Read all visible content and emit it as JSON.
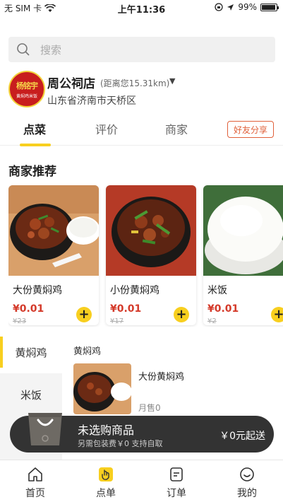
{
  "status_bar": {
    "carrier": "无 SIM 卡",
    "time": "上午11:36",
    "battery": "99%"
  },
  "search": {
    "placeholder": "搜索"
  },
  "store": {
    "logo_main": "杨铭宇",
    "logo_sub": "黄焖鸡米饭",
    "name": "周公祠店",
    "distance": "(距离您15.31km)",
    "caret": "▼",
    "address": "山东省济南市天桥区"
  },
  "tabs": [
    {
      "label": "点菜",
      "active": true
    },
    {
      "label": "评价",
      "active": false
    },
    {
      "label": "商家",
      "active": false
    }
  ],
  "share_label": "好友分享",
  "section_title": "商家推荐",
  "recommendations": [
    {
      "name": "大份黄焖鸡",
      "price": "¥0.01",
      "original_price": "¥23",
      "add_icon": "+"
    },
    {
      "name": "小份黄焖鸡",
      "price": "¥0.01",
      "original_price": "¥17",
      "add_icon": "+"
    },
    {
      "name": "米饭",
      "price": "¥0.01",
      "original_price": "¥2",
      "add_icon": "+"
    }
  ],
  "categories": [
    {
      "label": "黄焖鸡",
      "active": true
    },
    {
      "label": "米饭",
      "active": false
    }
  ],
  "menu": {
    "section_title": "黄焖鸡",
    "dish_name": "大份黄焖鸡",
    "dish_sales": "月售0"
  },
  "cart": {
    "title": "未选购商品",
    "subtitle": "另需包装费￥0   支持自取",
    "min_order": "￥0元起送"
  },
  "bottom_nav": [
    {
      "label": "首页",
      "icon": "home-icon"
    },
    {
      "label": "点单",
      "icon": "order-hand-icon"
    },
    {
      "label": "订单",
      "icon": "orders-list-icon"
    },
    {
      "label": "我的",
      "icon": "profile-icon"
    }
  ],
  "colors": {
    "accent": "#f8cf1f",
    "price": "#d43a2a",
    "share": "#e0603a",
    "cart_bar": "#333333"
  }
}
